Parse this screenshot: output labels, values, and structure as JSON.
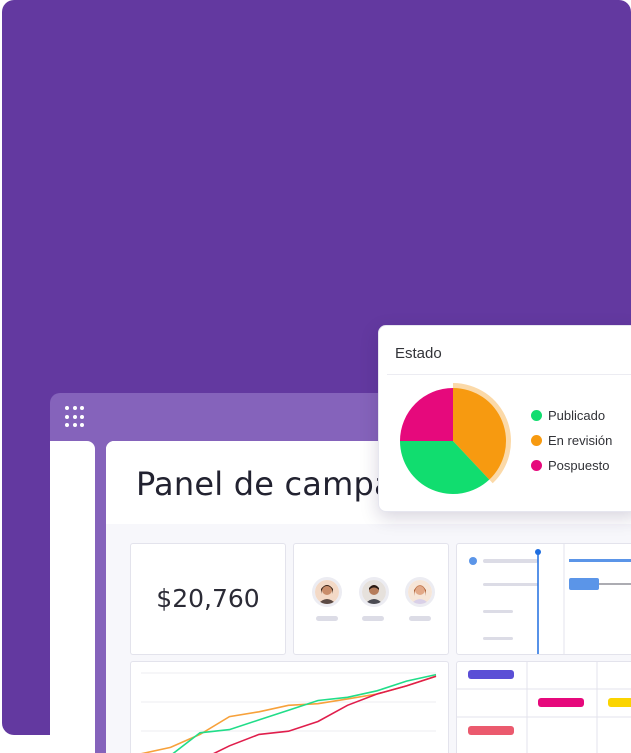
{
  "dashboard": {
    "title": "Panel de campa",
    "revenue_value": "$20,760"
  },
  "status_widget": {
    "title": "Estado",
    "legend": [
      {
        "label": "Publicado",
        "color": "#11dd6f"
      },
      {
        "label": "En revisión",
        "color": "#f79a10"
      },
      {
        "label": "Pospuesto",
        "color": "#e6097c"
      }
    ]
  },
  "chart_data": {
    "type": "pie",
    "title": "Estado",
    "categories": [
      "Publicado",
      "En revisión",
      "Pospuesto"
    ],
    "values": [
      37,
      38,
      25
    ],
    "colors": [
      "#11dd6f",
      "#f79a10",
      "#e6097c"
    ]
  },
  "line_chart_data": {
    "type": "line",
    "x": [
      0,
      1,
      2,
      3,
      4,
      5,
      6,
      7,
      8,
      9,
      10
    ],
    "series": [
      {
        "color": "#f7a13b",
        "values": [
          10,
          14,
          22,
          33,
          36,
          40,
          41,
          44,
          47,
          52,
          58
        ]
      },
      {
        "color": "#21dd89",
        "values": [
          0,
          9,
          23,
          25,
          31,
          37,
          43,
          45,
          49,
          55,
          59
        ]
      },
      {
        "color": "#e01e4c",
        "values": [
          0,
          2,
          6,
          15,
          22,
          24,
          30,
          40,
          47,
          52,
          58
        ]
      }
    ]
  },
  "colors": {
    "background": "#6339a0",
    "header_bar": "#8563bb",
    "accent_blue": "#1f6ee0",
    "bar_blue": "#5b95e8",
    "bar_purple": "#5b4fd6",
    "bar_pink": "#e6097c",
    "bar_red": "#eb5a6e",
    "bar_yellow": "#fbd400"
  },
  "icons": {
    "app_menu": "grid-dots-icon"
  }
}
